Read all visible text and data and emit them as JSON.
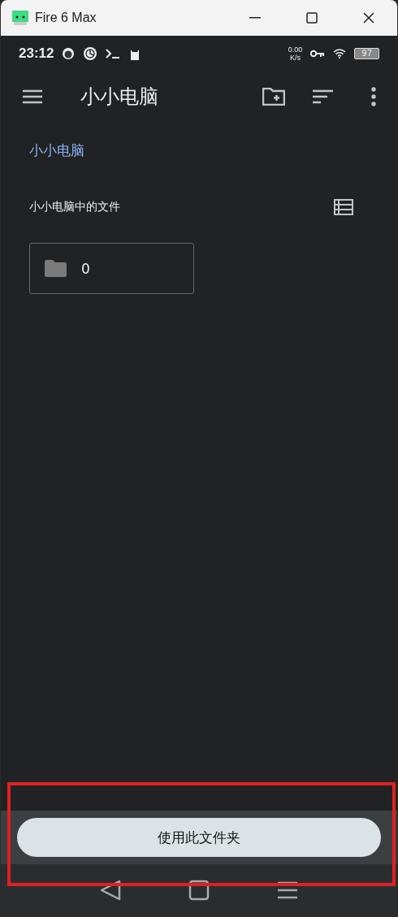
{
  "window": {
    "title": "Fire 6 Max"
  },
  "status_bar": {
    "time": "23:12",
    "speed_value": "0.00",
    "speed_unit": "K/s",
    "battery": "97"
  },
  "app_bar": {
    "title": "小小电脑"
  },
  "breadcrumb": "小小电脑",
  "section": {
    "title": "小小电脑中的文件"
  },
  "folders": [
    {
      "name": "0"
    }
  ],
  "action_button": "使用此文件夹",
  "highlight": {
    "color": "#e02020"
  }
}
